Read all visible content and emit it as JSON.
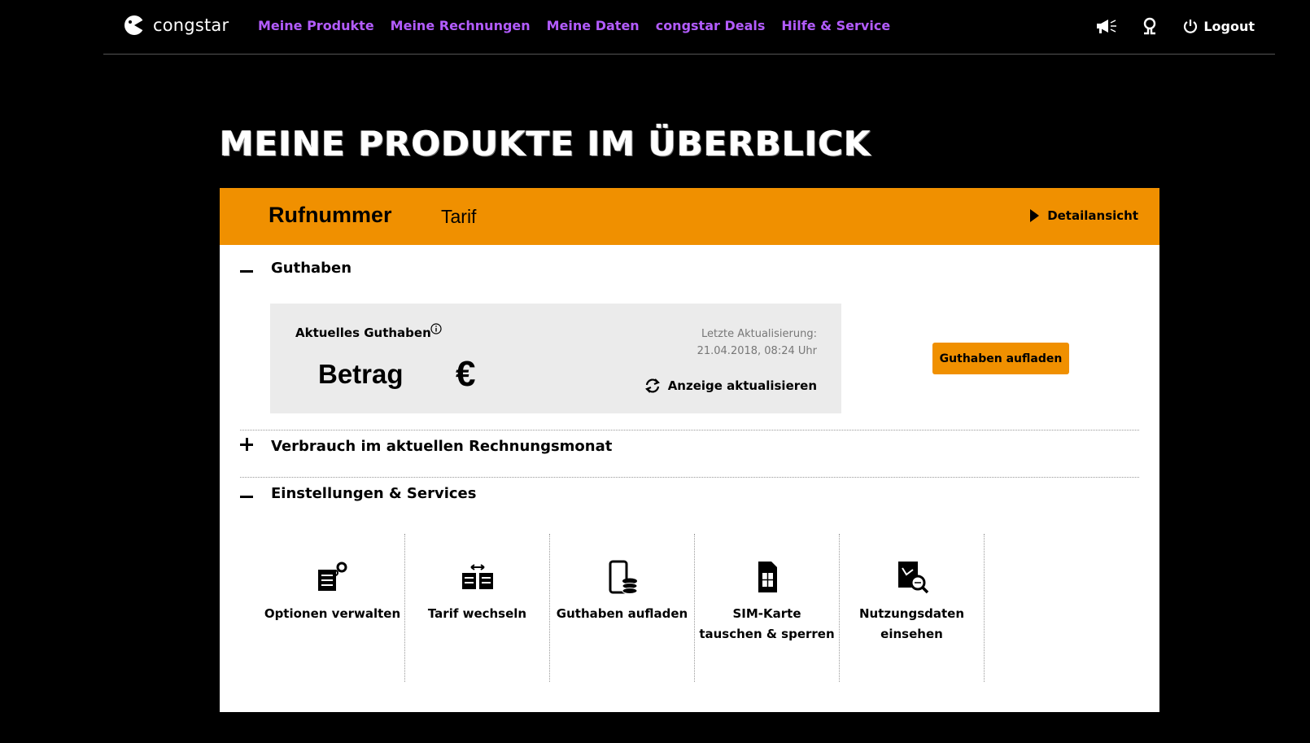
{
  "header": {
    "logo_text": "congstar",
    "nav": [
      {
        "label": "Meine Produkte"
      },
      {
        "label": "Meine Rechnungen"
      },
      {
        "label": "Meine Daten"
      },
      {
        "label": "congstar Deals"
      },
      {
        "label": "Hilfe & Service"
      }
    ],
    "logout_label": "Logout",
    "nav_color": "#b35cff"
  },
  "page": {
    "title": "Meine Produkte im Überblick"
  },
  "product": {
    "number_label": "Rufnummer",
    "tariff_label": "Tarif",
    "detail_label": "Detailansicht",
    "accent_color": "#f09000"
  },
  "balance_section": {
    "heading": "Guthaben",
    "current_label": "Aktuelles Guthaben",
    "amount": "Betrag",
    "currency": "€",
    "update_label": "Letzte Aktualisierung:",
    "update_time": "21.04.2018, 08:24 Uhr",
    "refresh_label": "Anzeige aktualisieren",
    "topup_button": "Guthaben aufladen"
  },
  "usage_section": {
    "heading": "Verbrauch im aktuellen Rechnungsmonat"
  },
  "settings_section": {
    "heading": "Einstellungen & Services",
    "items": [
      {
        "label": "Optionen verwalten",
        "icon": "options-gear-icon"
      },
      {
        "label": "Tarif wechseln",
        "icon": "tariff-switch-icon"
      },
      {
        "label": "Guthaben aufladen",
        "icon": "phone-coins-icon"
      },
      {
        "label": "SIM-Karte\ntauschen & sperren",
        "icon": "sim-card-icon"
      },
      {
        "label": "Nutzungsdaten\neinsehen",
        "icon": "usage-data-icon"
      }
    ]
  }
}
